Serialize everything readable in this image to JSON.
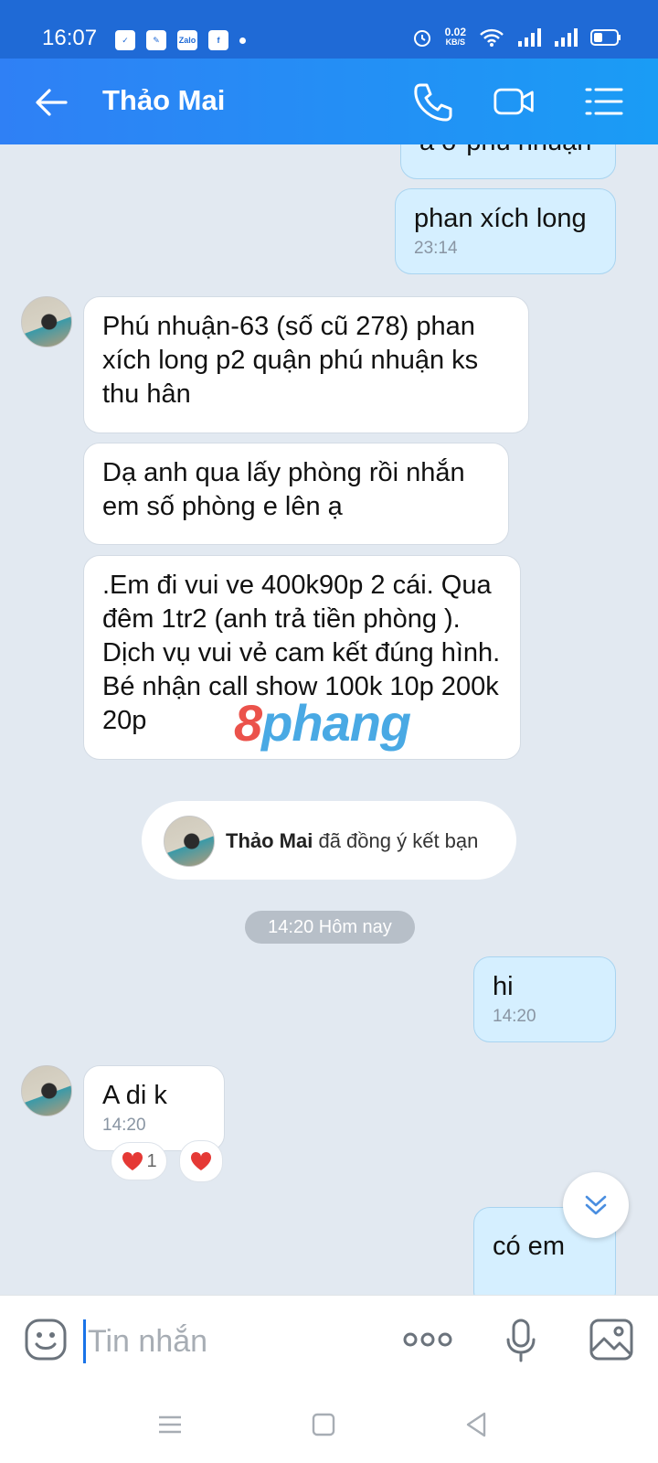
{
  "status_bar": {
    "time": "16:07",
    "net_speed": "0.02",
    "net_unit": "KB/S",
    "app_icons": [
      "check-icon",
      "bluetooth-app-icon",
      "Zalo",
      "facebook-icon"
    ]
  },
  "header": {
    "contact_name": "Thảo Mai"
  },
  "messages": {
    "m0": {
      "text": "a ở phú nhuận"
    },
    "m1": {
      "text": "phan xích long",
      "time": "23:14"
    },
    "m2": {
      "text": "Phú nhuận-63 (số cũ 278) phan xích long p2 quận phú nhuận ks thu hân"
    },
    "m3": {
      "text": "Dạ anh qua lấy phòng rồi nhắn em số phòng e lên ạ"
    },
    "m4": {
      "text": ".Em đi vui ve 400k90p 2 cái. Qua đêm 1tr2 (anh trả tiền phòng ). Dịch vụ vui vẻ cam kết đúng hình. Bé nhận call show 100k 10p 200k 20p"
    },
    "m5": {
      "text": "hi",
      "time": "14:20"
    },
    "m6": {
      "text": "A di k",
      "time": "14:20"
    },
    "m7": {
      "text": "có em"
    }
  },
  "system": {
    "friend_name": "Thảo Mai",
    "friend_text": "đã đồng ý kết bạn",
    "date_divider": "14:20 Hôm nay"
  },
  "reactions": {
    "count": "1"
  },
  "watermark": {
    "part1": "8",
    "part2": "phang"
  },
  "composer": {
    "placeholder": "Tin nhắn"
  },
  "colors": {
    "header": "#2f80f5",
    "bubble_out": "#d5efff",
    "bubble_in": "#ffffff",
    "background": "#e2e9f1",
    "heart": "#e53935"
  }
}
